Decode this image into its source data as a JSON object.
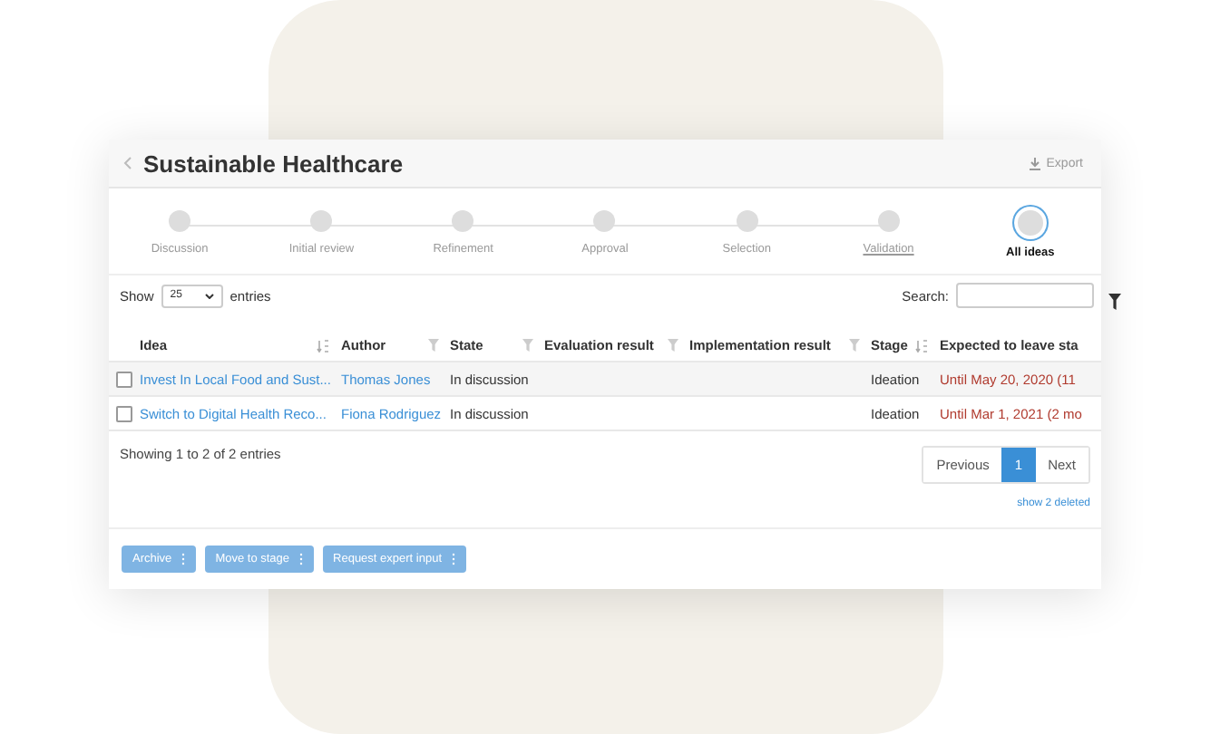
{
  "header": {
    "title": "Sustainable Healthcare",
    "export": "Export"
  },
  "stages": [
    {
      "label": "Discussion",
      "selected": false,
      "linked": false
    },
    {
      "label": "Initial review",
      "selected": false,
      "linked": false
    },
    {
      "label": "Refinement",
      "selected": false,
      "linked": false
    },
    {
      "label": "Approval",
      "selected": false,
      "linked": false
    },
    {
      "label": "Selection",
      "selected": false,
      "linked": false
    },
    {
      "label": "Validation",
      "selected": false,
      "linked": true
    },
    {
      "label": "All ideas",
      "selected": true,
      "linked": false
    }
  ],
  "controls": {
    "show_label": "Show",
    "page_size": "25",
    "entries_label": "entries",
    "search_label": "Search:"
  },
  "table": {
    "columns": [
      {
        "label": "Idea",
        "sortable": true,
        "filterable": false
      },
      {
        "label": "Author",
        "sortable": false,
        "filterable": true
      },
      {
        "label": "State",
        "sortable": false,
        "filterable": true
      },
      {
        "label": "Evaluation result",
        "sortable": false,
        "filterable": true
      },
      {
        "label": "Implementation result",
        "sortable": false,
        "filterable": true
      },
      {
        "label": "Stage",
        "sortable": true,
        "filterable": false
      },
      {
        "label": "Expected to leave sta",
        "sortable": false,
        "filterable": false
      }
    ],
    "rows": [
      {
        "checked": false,
        "idea": "Invest In Local Food and Sust...",
        "author": "Thomas Jones",
        "state": "In discussion",
        "stage": "Ideation",
        "expected": "Until May 20, 2020 (11"
      },
      {
        "checked": false,
        "idea": "Switch to Digital Health Reco...",
        "author": "Fiona Rodriguez",
        "state": "In discussion",
        "stage": "Ideation",
        "expected": "Until Mar 1, 2021 (2 mo"
      }
    ]
  },
  "footer": {
    "info": "Showing 1 to 2 of 2 entries",
    "pages": [
      {
        "label": "Previous",
        "selected": false
      },
      {
        "label": "1",
        "selected": true
      },
      {
        "label": "Next",
        "selected": false
      }
    ],
    "deleted_link": "show 2 deleted"
  },
  "actions": [
    "Archive",
    "Move to stage",
    "Request expert input"
  ]
}
